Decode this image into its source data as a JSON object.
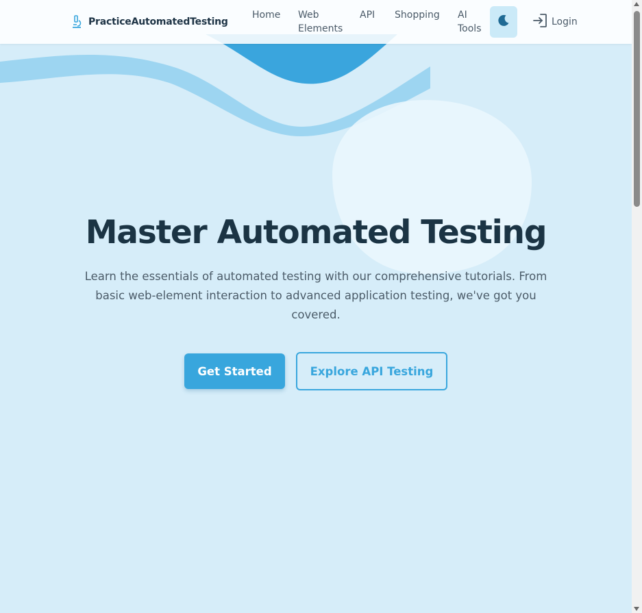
{
  "navbar": {
    "brand": "PracticeAutomatedTesting",
    "items": [
      {
        "label": "Home"
      },
      {
        "label": "Web Elements"
      },
      {
        "label": "API"
      },
      {
        "label": "Shopping"
      },
      {
        "label": "AI Tools"
      }
    ],
    "theme_toggle_icon": "moon-icon",
    "login_label": "Login",
    "login_icon": "login-arrow-icon"
  },
  "hero": {
    "title": "Master Automated Testing",
    "description": "Learn the essentials of automated testing with our comprehensive tutorials. From basic web-element interaction to advanced application testing, we've got you covered.",
    "primary_button": "Get Started",
    "secondary_button": "Explore API Testing"
  },
  "colors": {
    "background": "#d6edf9",
    "accent": "#38a6dd",
    "title": "#1b3444",
    "wave_light": "#9dd5f1",
    "wave_dark": "#3aa5dd"
  }
}
